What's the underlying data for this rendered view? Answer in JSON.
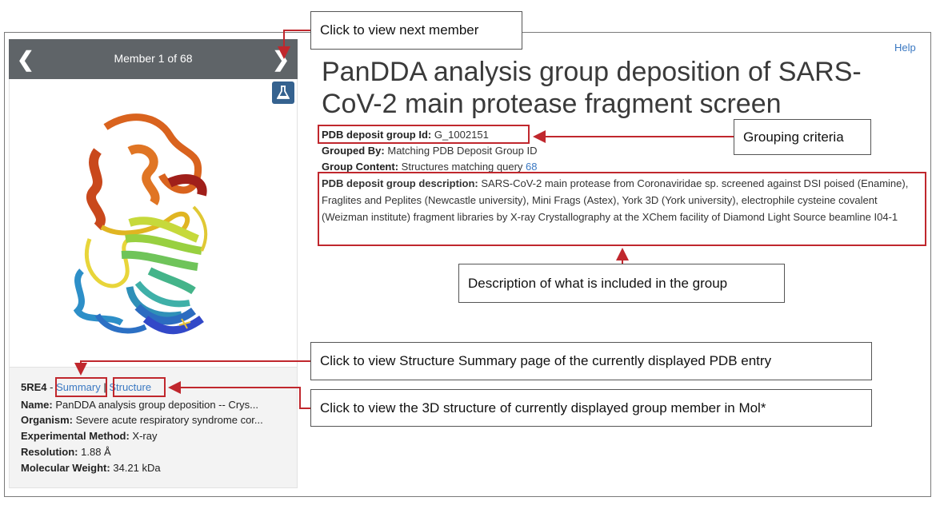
{
  "carousel": {
    "prev_icon": "chevron-left-icon",
    "prev_glyph": "❮",
    "counter": "Member 1 of 68",
    "next_icon": "chevron-right-icon",
    "next_glyph": "❯",
    "flask_icon": "flask-icon"
  },
  "member": {
    "id": "5RE4",
    "separator": " - ",
    "summary_link": "Summary",
    "pipe": " | ",
    "structure_link": "Structure",
    "name_label": "Name:",
    "name_value": "PanDDA analysis group deposition -- Crys...",
    "organism_label": "Organism:",
    "organism_value": "Severe acute respiratory syndrome cor...",
    "method_label": "Experimental Method:",
    "method_value": "X-ray",
    "resolution_label": "Resolution:",
    "resolution_value": "1.88 Å",
    "weight_label": "Molecular Weight:",
    "weight_value": "34.21 kDa"
  },
  "page": {
    "help": "Help",
    "title": "PanDDA analysis group deposition of SARS-CoV-2 main protease fragment screen",
    "group_id_label": "PDB deposit group Id:",
    "group_id_value": "G_1002151",
    "grouped_by_label": "Grouped By:",
    "grouped_by_value": "Matching PDB Deposit Group ID",
    "content_label": "Group Content:",
    "content_value": "Structures matching query",
    "content_count": "68",
    "description_label": "PDB deposit group description:",
    "description_value": "SARS-CoV-2 main protease from Coronaviridae sp. screened against DSI poised (Enamine), Fraglites and Peplites (Newcastle university), Mini Frags (Astex), York 3D (York university), electrophile cysteine covalent (Weizman institute) fragment libraries by X-ray Crystallography at the XChem facility of Diamond Light Source beamline I04-1"
  },
  "annotations": {
    "next_member": "Click to view next member",
    "grouping": "Grouping criteria",
    "description": "Description of what is included in the group",
    "summary": "Click to view Structure Summary page of the currently displayed PDB entry",
    "structure": "Click to view the 3D structure of currently displayed group member in Mol*",
    "highlight_color": "#c0272d"
  }
}
